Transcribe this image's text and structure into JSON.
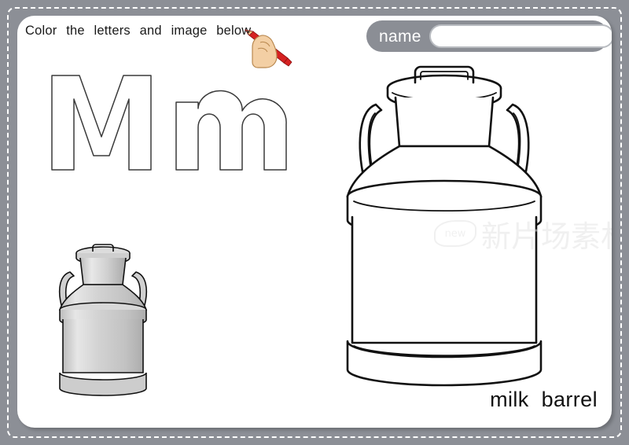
{
  "worksheet": {
    "instruction": "Color the letters and image below.",
    "border_color": "#8c8f96",
    "page_color": "#ffffff",
    "stitch_color": "#ffffff"
  },
  "name_field": {
    "label": "name",
    "value": "",
    "placeholder": "",
    "background": "#8b8e95",
    "input_background": "#ffffff"
  },
  "letters": {
    "uppercase": "M",
    "lowercase": "m",
    "outline_color": "#3a3a3a",
    "fill": "#ffffff"
  },
  "picture": {
    "word": "milk  barrel",
    "subject": "milk-barrel",
    "small_image_colors": {
      "body_light": "#e3e3e3",
      "body_mid": "#cccccc",
      "body_dark": "#b4b4b4",
      "outline": "#111111"
    },
    "large_image_colors": {
      "fill": "#ffffff",
      "outline": "#111111"
    }
  },
  "icons": {
    "hand_pencil": "hand-holding-pencil-icon",
    "pencil_color": "#d62121",
    "skin_color": "#f3cfa4"
  },
  "watermark": {
    "badge": "new",
    "text": "新片场素材"
  }
}
